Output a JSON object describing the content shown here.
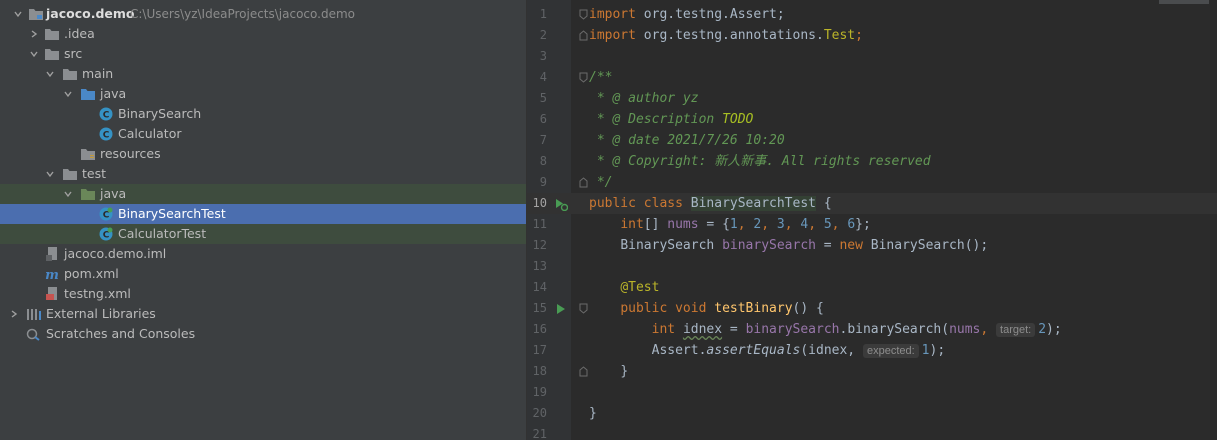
{
  "project": {
    "root_name": "jacoco.demo",
    "root_path": "C:\\Users\\yz\\IdeaProjects\\jacoco.demo",
    "items": {
      "idea": ".idea",
      "src": "src",
      "main": "main",
      "main_java": "java",
      "binary_search": "BinarySearch",
      "calculator": "Calculator",
      "resources": "resources",
      "test": "test",
      "test_java": "java",
      "binary_search_test": "BinarySearchTest",
      "calculator_test": "CalculatorTest",
      "iml": "jacoco.demo.iml",
      "pom": "pom.xml",
      "testng": "testng.xml",
      "external_libraries": "External Libraries",
      "scratches": "Scratches and Consoles"
    }
  },
  "editor": {
    "line_numbers": [
      "1",
      "2",
      "3",
      "4",
      "5",
      "6",
      "7",
      "8",
      "9",
      "10",
      "11",
      "12",
      "13",
      "14",
      "15",
      "16",
      "17",
      "18",
      "19",
      "20",
      "21"
    ],
    "tokens": {
      "import": "import",
      "l1_pkg": " org.testng.Assert;",
      "l2_pkg": " org.testng.annotations.",
      "l2_test": "Test",
      "l2_semi": ";",
      "l4": "/**",
      "l5": " * @ author yz",
      "l6_a": " * @ Description ",
      "l6_todo": "TODO",
      "l7": " * @ date 2021/7/26 10:20",
      "l8": " * @ Copyright: 新人新事. All rights reserved",
      "l9": " */",
      "public": "public",
      "class": " class ",
      "class_name": "BinarySearchTest",
      "brace_open": " {",
      "indent1": "    ",
      "indent2": "        ",
      "int_arr": "int",
      "arr_brackets": "[] ",
      "nums": "nums",
      "assign_open": " = {",
      "n1": "1",
      "n2": "2",
      "n3": "3",
      "n4": "4",
      "n5": "5",
      "n6": "6",
      "comma": ", ",
      "close_arr": "};",
      "bs_type": "BinarySearch ",
      "bs_field": "binarySearch",
      "eq": " = ",
      "new": "new",
      "bs_ctor": " BinarySearch();",
      "annotation": "@Test",
      "void": " void ",
      "method": "testBinary",
      "method_sig": "() {",
      "int": "int",
      "idnex": "idnex",
      "dot": ".",
      "bs_call": "binarySearch(",
      "hint_target": "target:",
      "two": "2",
      "close_call": ");",
      "assert": "Assert.",
      "assert_eq": "assertEquals",
      "paren_idnex": "(idnex, ",
      "hint_expected": "expected:",
      "one": "1",
      "close_brace": "}"
    }
  },
  "icons": {
    "folder_color": "#8b8e91",
    "source_folder_color": "#4a88c7",
    "test_folder_color": "#6a8759",
    "class_icon_color": "#3592c4",
    "run_icon_color": "#499c54"
  }
}
